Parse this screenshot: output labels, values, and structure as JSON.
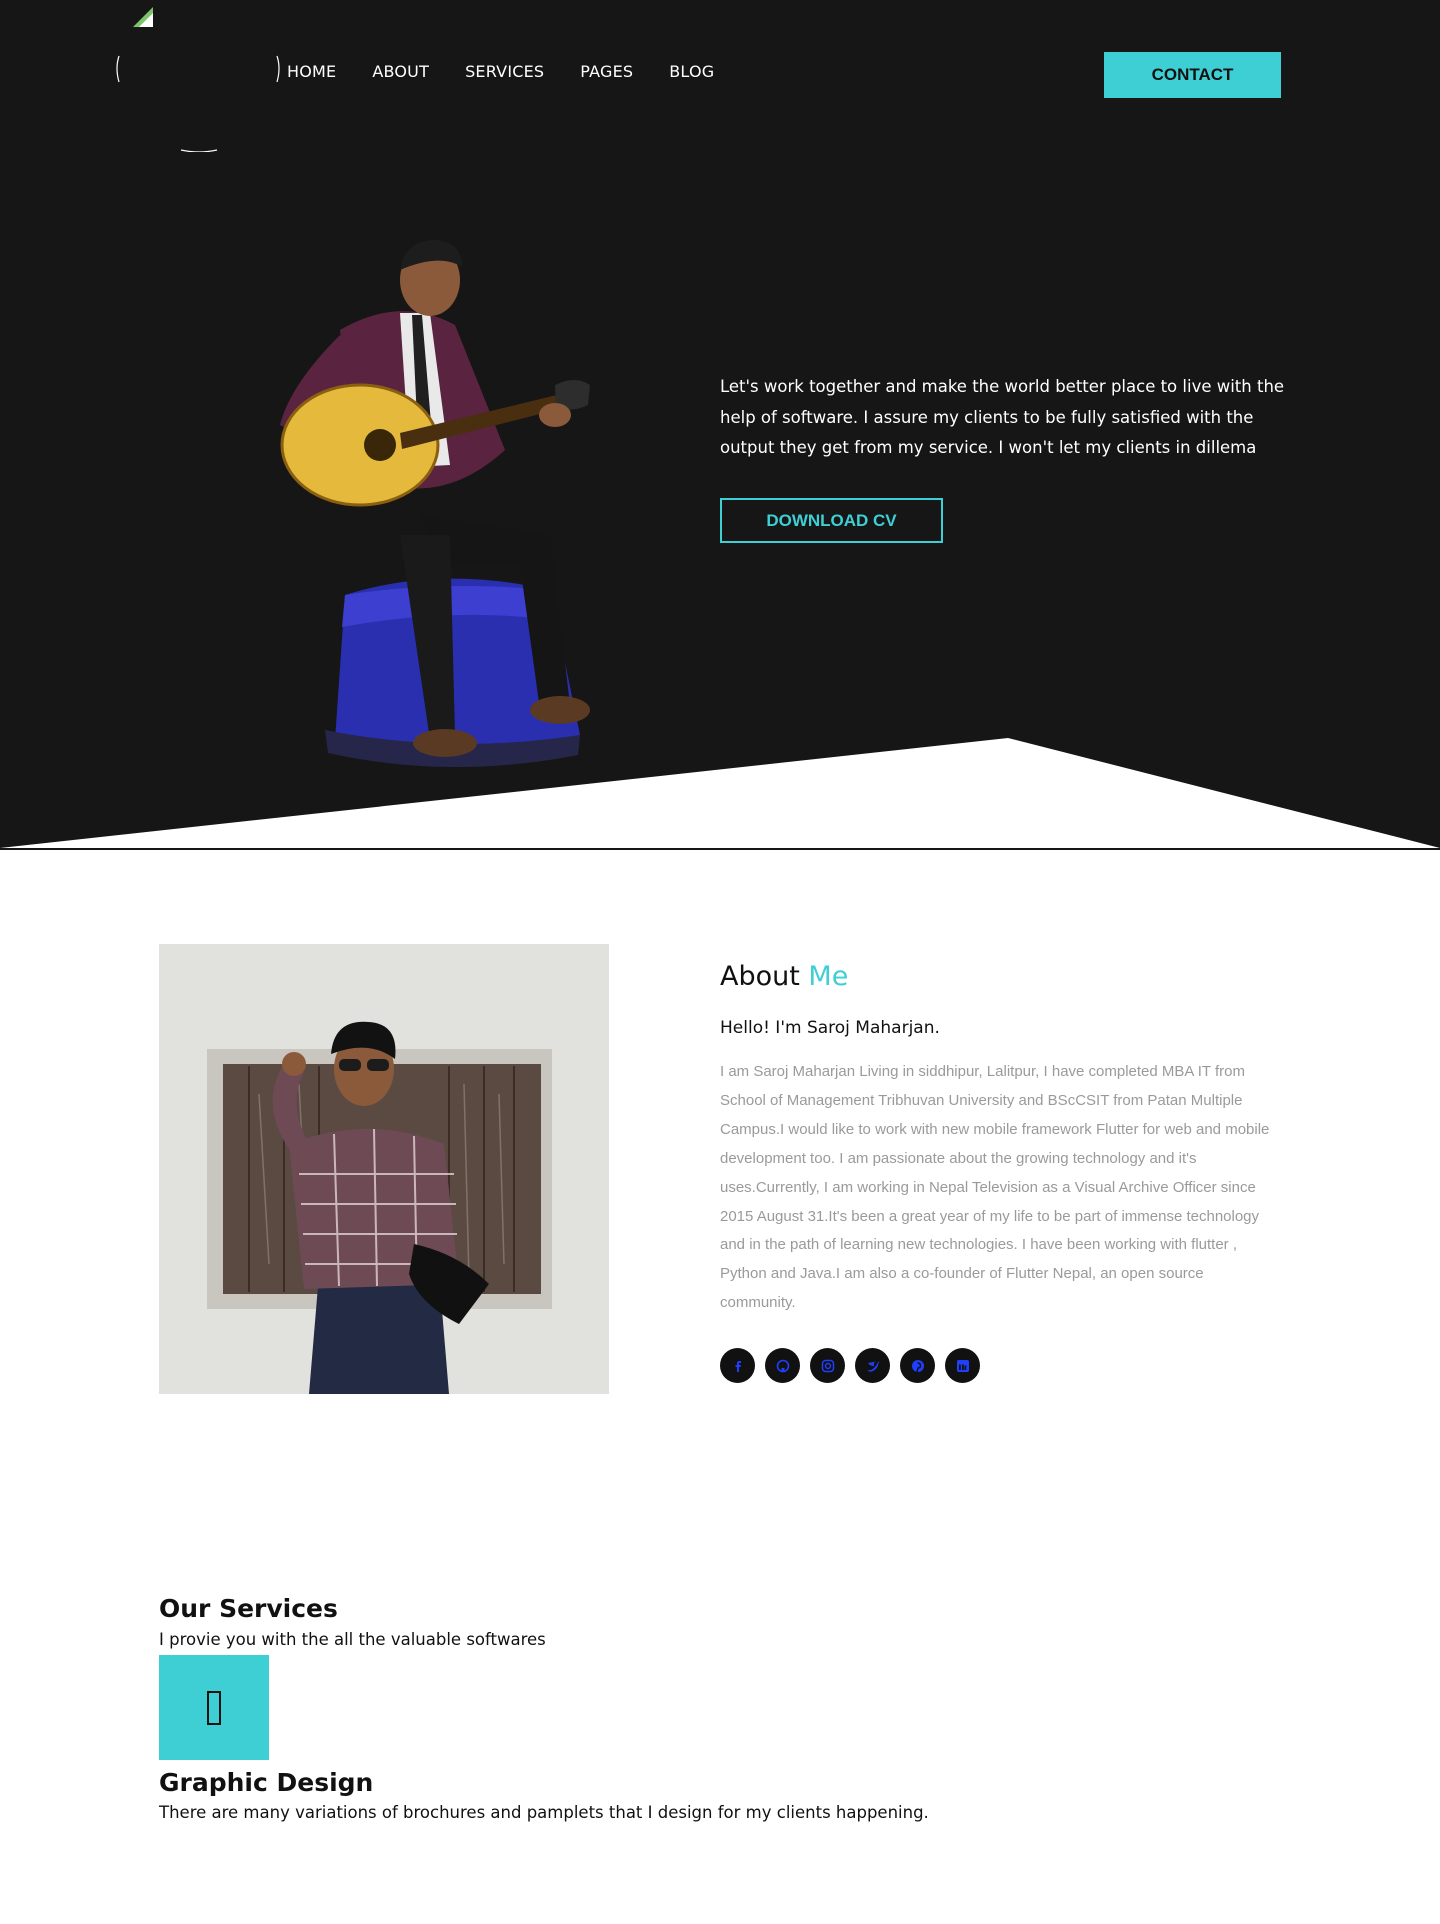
{
  "header": {
    "nav": [
      "HOME",
      "ABOUT",
      "SERVICES",
      "PAGES",
      "BLOG"
    ],
    "contact_label": "CONTACT"
  },
  "hero": {
    "text": "Let's work together and make the world better place to live with the help of software. I assure my clients to be fully satisfied with the output they get from my service. I won't let my clients in dillema",
    "cv_label": "DOWNLOAD CV"
  },
  "about": {
    "title": "About",
    "title_accent": "Me",
    "hello": "Hello! I'm Saroj Maharjan.",
    "body": "I am Saroj Maharjan Living in siddhipur, Lalitpur, I have completed MBA IT from School of Management Tribhuvan University and BScCSIT from Patan Multiple Campus.I would like to work with new mobile framework Flutter for web and mobile development too. I am passionate about the growing technology and it's uses.Currently, I am working in Nepal Television as a Visual Archive Officer since 2015 August 31.It's been a great year of my life to be part of immense technology and in the path of learning new technologies. I have been working with flutter , Python and Java.I am also a co-founder of Flutter Nepal, an open source community.",
    "socials": [
      "facebook-icon",
      "github-icon",
      "instagram-icon",
      "twitter-icon",
      "pinterest-icon",
      "linkedin-icon"
    ]
  },
  "services": {
    "title": "Our Services",
    "subtitle": "I provie you with the all the valuable softwares",
    "items": [
      {
        "icon": "design-icon",
        "title": "Graphic Design",
        "description": "There are many variations of brochures and pamplets that I design for my clients happening."
      }
    ]
  },
  "colors": {
    "accent": "#3ecfd5",
    "dark": "#161617",
    "muted_text": "#9a9a9a"
  }
}
